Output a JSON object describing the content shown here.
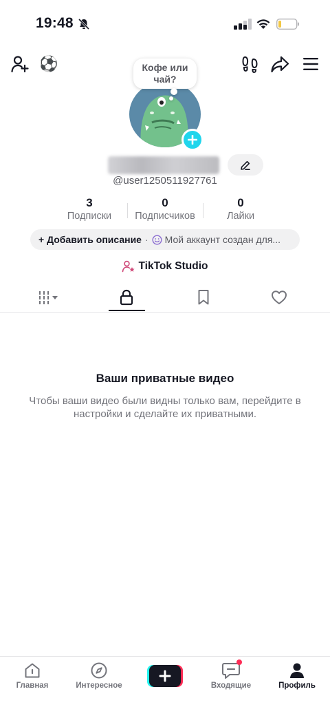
{
  "status_bar": {
    "time": "19:48"
  },
  "header": {
    "emoji": "⚽"
  },
  "avatar": {
    "bubble_text": "Кофе или чай?"
  },
  "profile": {
    "username": "@user1250511927761"
  },
  "stats": [
    {
      "value": "3",
      "label": "Подписки"
    },
    {
      "value": "0",
      "label": "Подписчиков"
    },
    {
      "value": "0",
      "label": "Лайки"
    }
  ],
  "bio": {
    "add_label": "+ Добавить описание",
    "separator": "·",
    "suggestion": "Мой аккаунт создан для..."
  },
  "studio": {
    "label": "TikTok Studio"
  },
  "empty_state": {
    "title": "Ваши приватные видео",
    "description": "Чтобы ваши видео были видны только вам, перейдите в настройки и сделайте их приватными."
  },
  "bottom_nav": {
    "items": [
      {
        "label": "Главная"
      },
      {
        "label": "Интересное"
      },
      {
        "label": "Входящие"
      },
      {
        "label": "Профиль"
      }
    ]
  },
  "colors": {
    "accent_cyan": "#20d5ec",
    "accent_red": "#fe2c55",
    "text_primary": "#161823",
    "text_secondary": "#73747b"
  }
}
